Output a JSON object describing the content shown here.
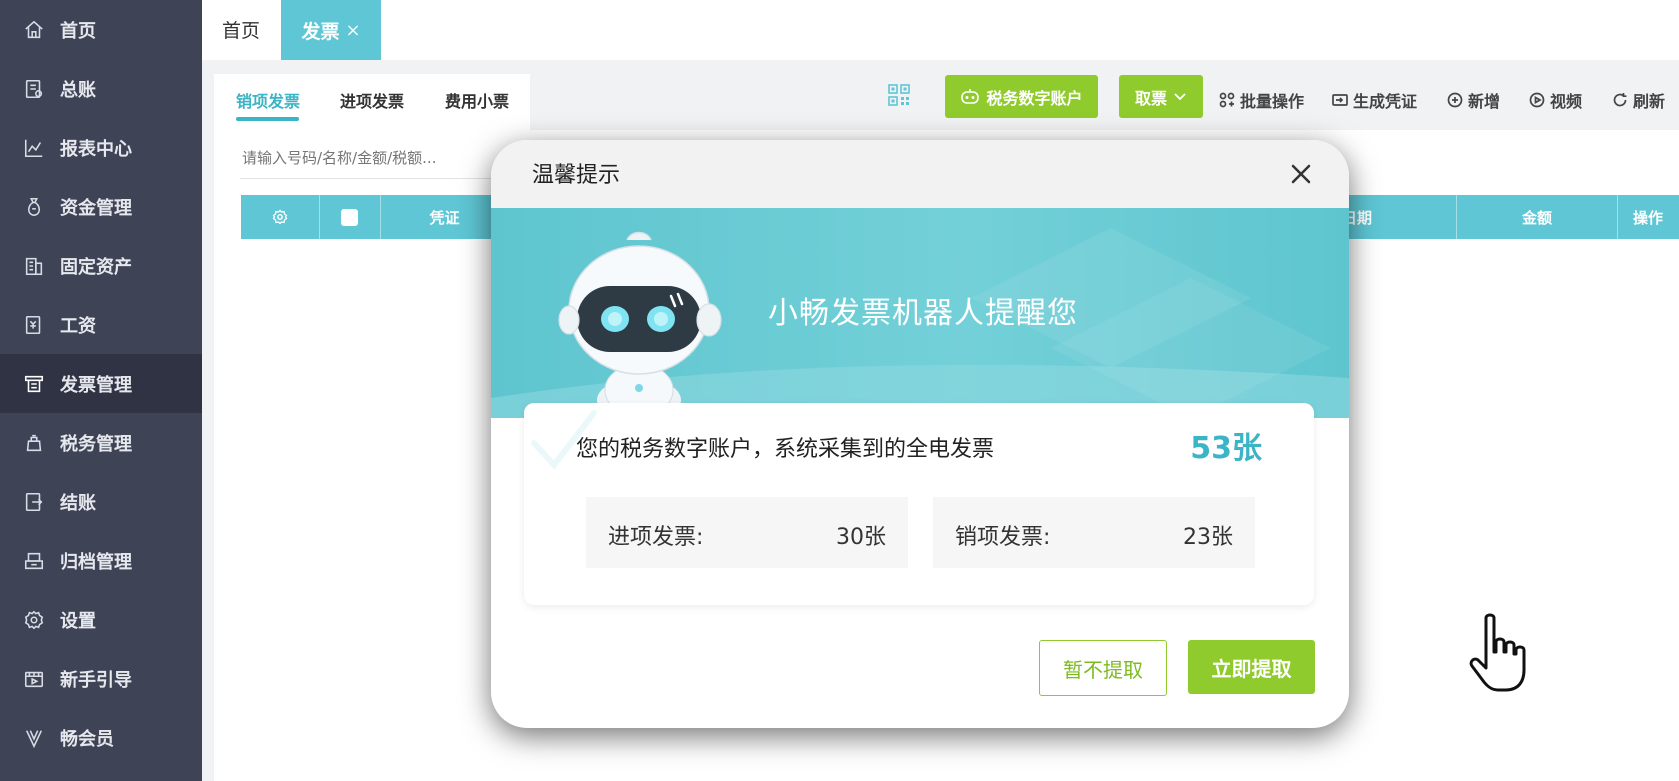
{
  "sidebar": {
    "items": [
      {
        "label": "首页",
        "icon": "home-icon"
      },
      {
        "label": "总账",
        "icon": "ledger-icon"
      },
      {
        "label": "报表中心",
        "icon": "chart-icon"
      },
      {
        "label": "资金管理",
        "icon": "money-bag-icon"
      },
      {
        "label": "固定资产",
        "icon": "building-icon"
      },
      {
        "label": "工资",
        "icon": "salary-icon"
      },
      {
        "label": "发票管理",
        "icon": "invoice-icon"
      },
      {
        "label": "税务管理",
        "icon": "tax-icon"
      },
      {
        "label": "结账",
        "icon": "checkout-icon"
      },
      {
        "label": "归档管理",
        "icon": "archive-icon"
      },
      {
        "label": "设置",
        "icon": "gear-icon"
      },
      {
        "label": "新手引导",
        "icon": "guide-icon"
      },
      {
        "label": "畅会员",
        "icon": "vip-icon"
      }
    ],
    "active_index": 6
  },
  "tabs": {
    "home": "首页",
    "active": "发票",
    "close": "×"
  },
  "subtabs": [
    "销项发票",
    "进项发票",
    "费用小票"
  ],
  "search": {
    "placeholder": "请输入号码/名称/金额/税额..."
  },
  "table": {
    "headers": [
      "凭证",
      "日期",
      "金额",
      "操作"
    ]
  },
  "toolbar": {
    "tax_account": "税务数字账户",
    "fetch": "取票",
    "batch": "批量操作",
    "voucher": "生成凭证",
    "add": "新增",
    "video": "视频",
    "refresh": "刷新"
  },
  "dialog": {
    "title": "温馨提示",
    "banner": "小畅发票机器人提醒您",
    "message": "您的税务数字账户，系统采集到的全电发票",
    "total": "53张",
    "stats": [
      {
        "label": "进项发票:",
        "value": "30张"
      },
      {
        "label": "销项发票:",
        "value": "23张"
      }
    ],
    "btn_later": "暂不提取",
    "btn_now": "立即提取"
  },
  "colors": {
    "sidebar_bg": "#3e4356",
    "accent_teal": "#5ec6d4",
    "accent_green": "#8fcb2d"
  }
}
